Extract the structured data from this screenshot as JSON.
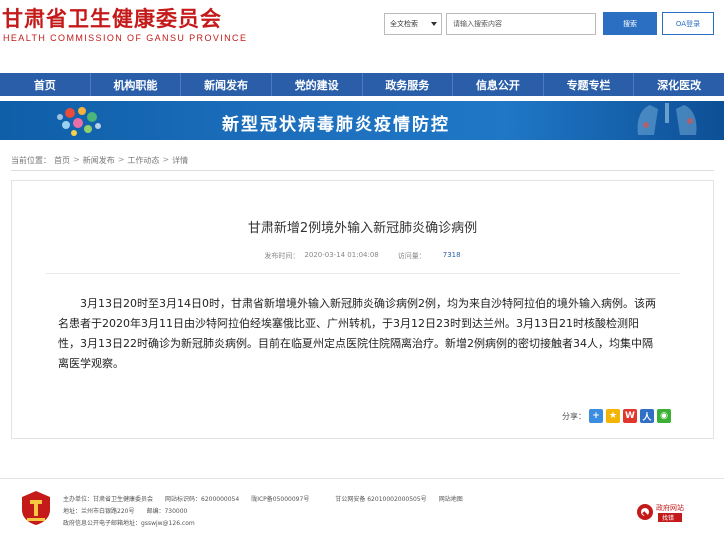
{
  "header": {
    "logo_cn": "甘肃省卫生健康委员会",
    "logo_en": "HEALTH COMMISSION OF GANSU PROVINCE",
    "search_scope": "全文检索",
    "search_placeholder": "请输入搜索内容",
    "search_button": "搜索",
    "oa_button": "OA登录"
  },
  "nav": {
    "items": [
      "首页",
      "机构职能",
      "新闻发布",
      "党的建设",
      "政务服务",
      "信息公开",
      "专题专栏",
      "深化医改"
    ]
  },
  "banner": {
    "title": "新型冠状病毒肺炎疫情防控"
  },
  "breadcrumb": {
    "label": "当前位置：",
    "items": [
      "首页",
      "新闻发布",
      "工作动态",
      "详情"
    ]
  },
  "article": {
    "title": "甘肃新增2例境外输入新冠肺炎确诊病例",
    "date_label": "发布时间：",
    "date": "2020-03-14 01:04:08",
    "views_label": "访问量：",
    "views": "7318",
    "body": "3月13日20时至3月14日0时，甘肃省新增境外输入新冠肺炎确诊病例2例，均为来自沙特阿拉伯的境外输入病例。该两名患者于2020年3月11日由沙特阿拉伯经埃塞俄比亚、广州转机，于3月12日23时到达兰州。3月13日21时核酸检测阳性，3月13日22时确诊为新冠肺炎病例。目前在临夏州定点医院住院隔离治疗。新增2例病例的密切接触者34人，均集中隔离医学观察。",
    "share_label": "分享："
  },
  "footer": {
    "host": "主办单位：甘肃省卫生健康委员会",
    "site_code": "网站标识码：6200000054",
    "icp": "陇ICP备05000097号",
    "police": "甘公网安备 62010002000505号",
    "sitemap": "网站地图",
    "address": "地址：兰州市白银路220号",
    "postcode": "邮编：730000",
    "email_label": "政府信息公开电子邮箱地址：",
    "email": "gsswjw@126.com",
    "gov_badge_top": "政府网站",
    "gov_badge_bottom": "找错"
  },
  "colors": {
    "brand_red": "#c41a1a",
    "nav_blue": "#2a5ea8",
    "link_blue": "#2a5ea8"
  }
}
